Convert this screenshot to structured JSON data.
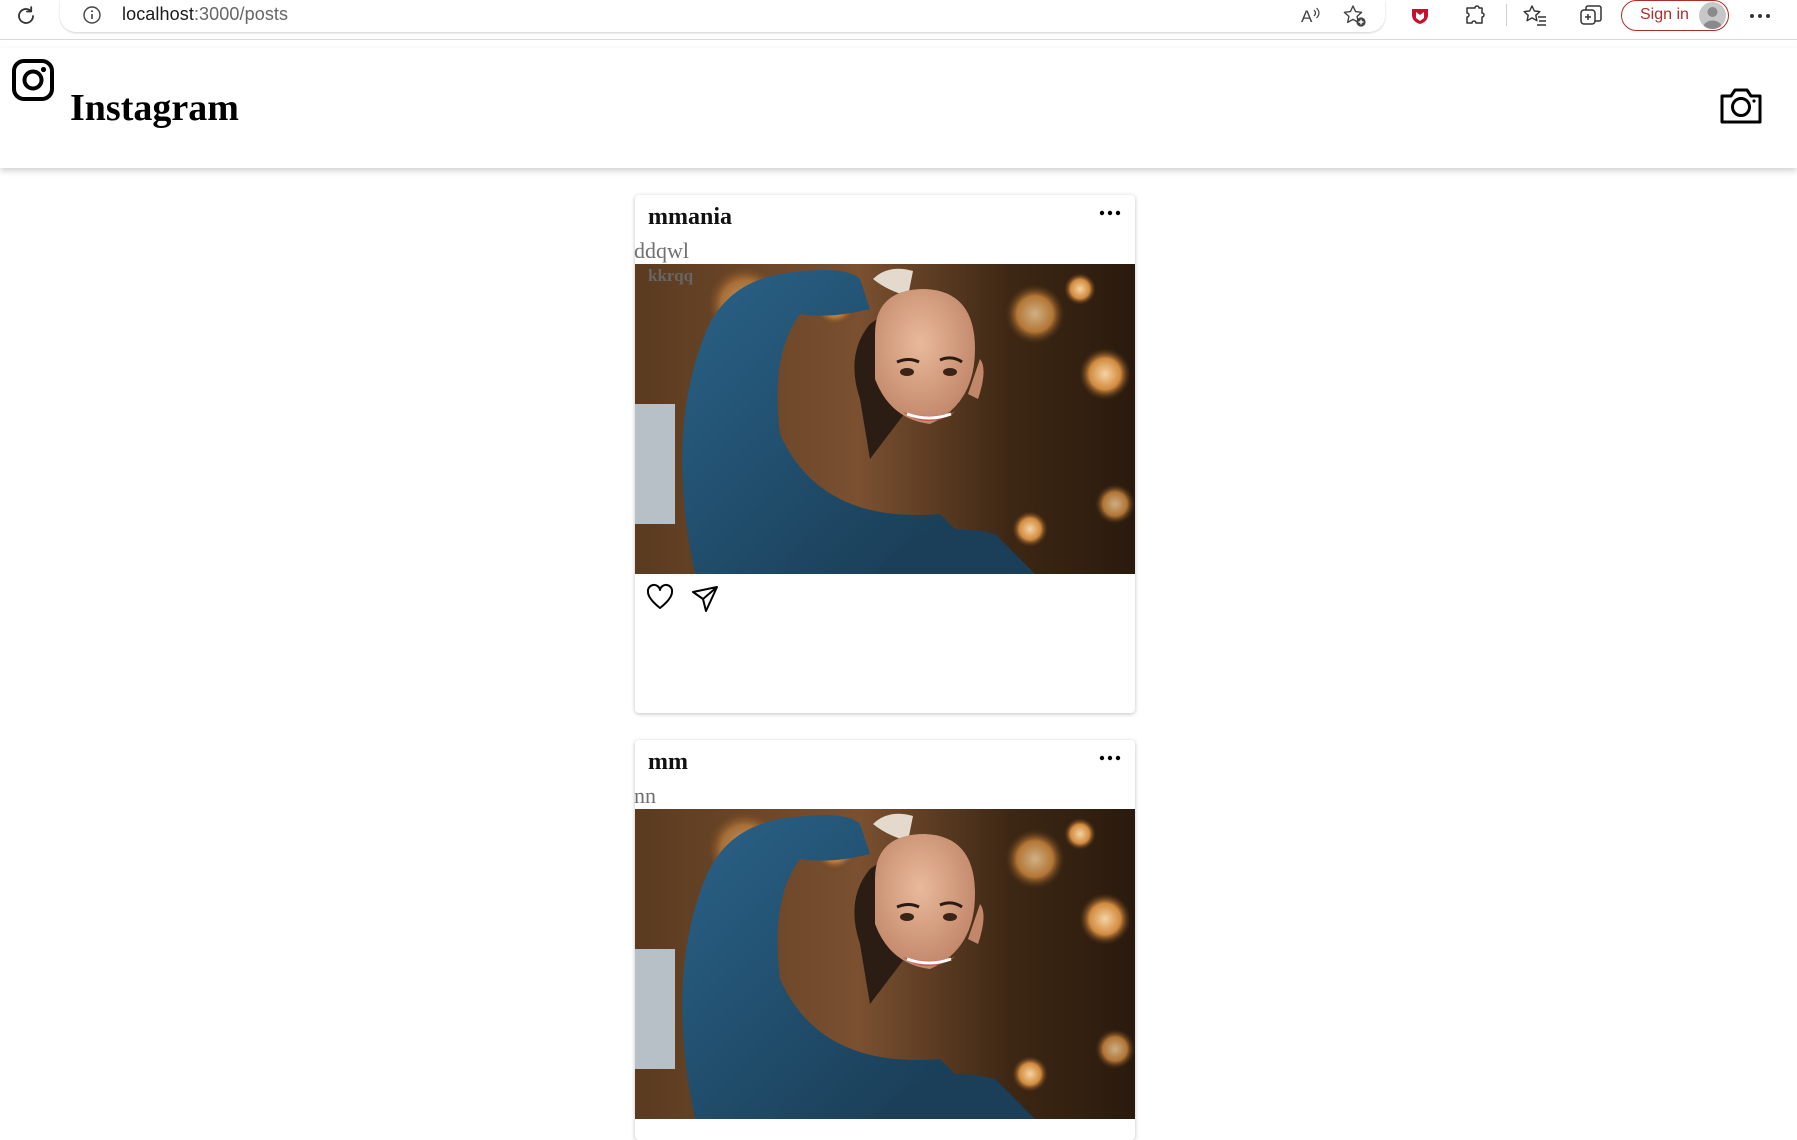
{
  "browser": {
    "url_host": "localhost",
    "url_path": ":3000/posts",
    "signin_label": "Sign in",
    "icons": [
      "reload-icon",
      "info-icon",
      "read-aloud-icon",
      "add-favorite-icon",
      "extension-shield-icon",
      "extensions-icon",
      "favorites-icon",
      "collections-icon",
      "profile-avatar-icon",
      "more-icon"
    ]
  },
  "header": {
    "brand_title": "Instagram",
    "logo_icon": "instagram-logo-icon",
    "camera_icon": "camera-icon"
  },
  "posts": [
    {
      "username": "mmania",
      "caption": "ddqwl",
      "comment": "kkrqq",
      "image": "portrait-photo-woman-blue-sweater"
    },
    {
      "username": "mm",
      "caption": "nn",
      "image": "portrait-photo-woman-blue-sweater"
    }
  ],
  "colors": {
    "signin_accent": "#b22b2b",
    "caption_gray": "#707070",
    "sweater_blue": "#1f4a68"
  }
}
